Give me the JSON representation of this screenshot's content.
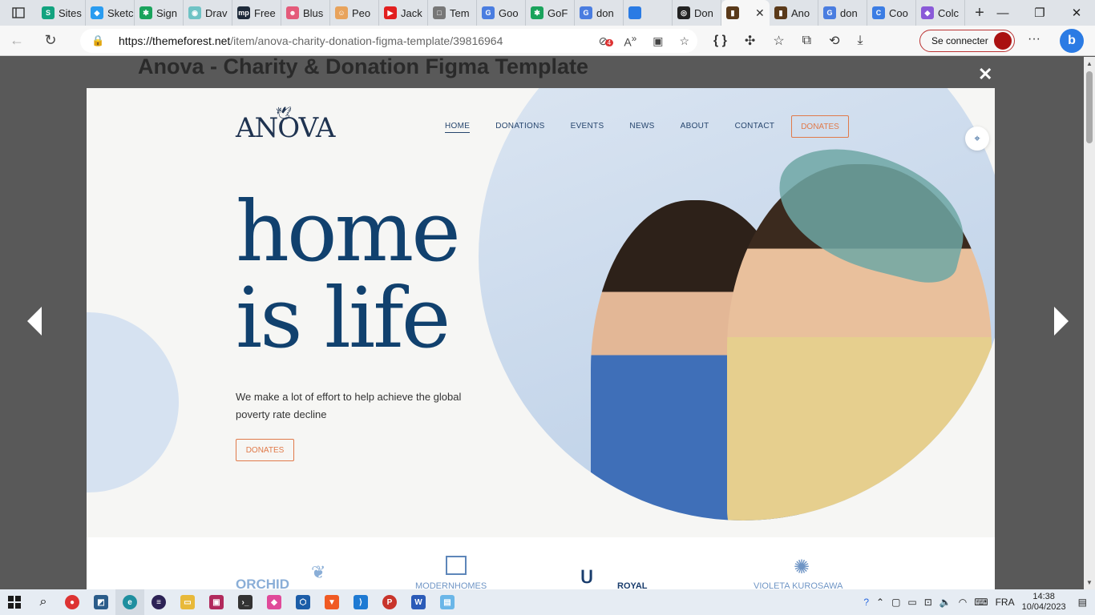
{
  "browser": {
    "tabs": [
      {
        "label": "Sites",
        "fav": "S",
        "color": "#12a37f"
      },
      {
        "label": "Sketc",
        "fav": "◆",
        "color": "#2a9cf0"
      },
      {
        "label": "Sign",
        "fav": "✱",
        "color": "#1aa35c"
      },
      {
        "label": "Drav",
        "fav": "◉",
        "color": "#6fc3c5"
      },
      {
        "label": "Free",
        "fav": "mp",
        "color": "#1e2a3a"
      },
      {
        "label": "Blus",
        "fav": "☻",
        "color": "#e45a7a"
      },
      {
        "label": "Peo",
        "fav": "☺",
        "color": "#e8a35c"
      },
      {
        "label": "Jack",
        "fav": "▶",
        "color": "#e21f1f"
      },
      {
        "label": "Tem",
        "fav": "□",
        "color": "#777777"
      },
      {
        "label": "Goo",
        "fav": "G",
        "color": "#4a7de0"
      },
      {
        "label": "GoF",
        "fav": "✱",
        "color": "#1aa35c"
      },
      {
        "label": "don",
        "fav": "G",
        "color": "#4a7de0"
      },
      {
        "label": "",
        "fav": "",
        "color": "#2a7be4"
      },
      {
        "label": "Don",
        "fav": "◎",
        "color": "#222222"
      }
    ],
    "active_tab": {
      "label": "",
      "fav": "▮",
      "color": "#5a3a1a"
    },
    "tabs_after": [
      {
        "label": "Ano",
        "fav": "▮",
        "color": "#5a3a1a"
      },
      {
        "label": "don",
        "fav": "G",
        "color": "#4a7de0"
      },
      {
        "label": "Coo",
        "fav": "C",
        "color": "#3b7de4"
      },
      {
        "label": "Colc",
        "fav": "◆",
        "color": "#8a5ad8"
      }
    ],
    "url_host": "https://themeforest.net",
    "url_path": "/item/anova-charity-donation-figma-template/39816964",
    "badge_count": "4",
    "signin_label": "Se connecter"
  },
  "page": {
    "title": "Anova - Charity & Donation Figma Template"
  },
  "site": {
    "logo": "ANOVA",
    "nav": [
      "HOME",
      "DONATIONS",
      "EVENTS",
      "NEWS",
      "ABOUT",
      "CONTACT"
    ],
    "nav_donate": "DONATES",
    "hero_line1": "home",
    "hero_line2": "is life",
    "hero_sub": "We make a lot of effort to help achieve the global poverty rate decline",
    "hero_button": "DONATES",
    "partners": {
      "orchid": "ORCHID",
      "modern": "MODERNHOMES",
      "royal": "ROYAL",
      "violeta": "VIOLETA KUROSAWA"
    }
  },
  "taskbar": {
    "language": "FRA",
    "time": "14:38",
    "date": "10/04/2023"
  },
  "colors": {
    "accent": "#e07a4a",
    "brand_navy": "#11416e"
  }
}
